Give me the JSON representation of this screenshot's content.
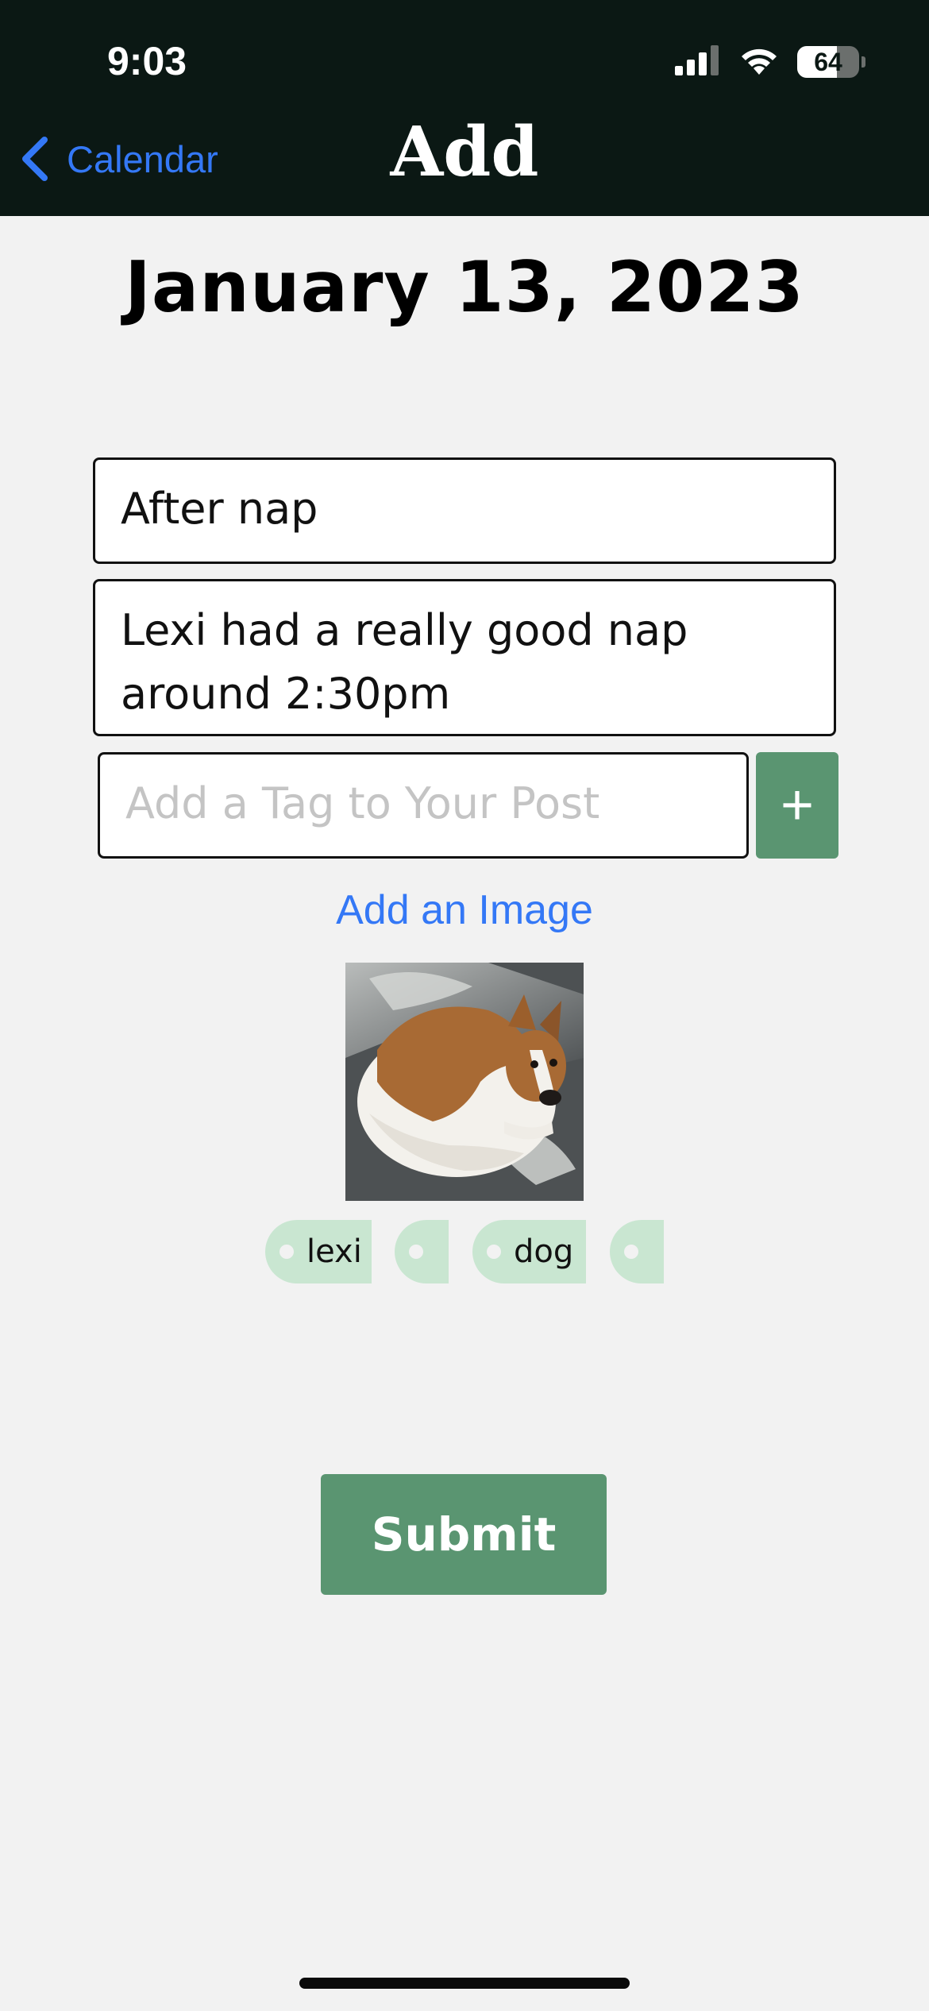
{
  "status_bar": {
    "time": "9:03",
    "battery": "64",
    "battery_level": 0.64
  },
  "nav": {
    "back_label": "Calendar",
    "title": "Add"
  },
  "date": "January 13, 2023",
  "form": {
    "title_value": "After nap",
    "description_value": "Lexi had a really good nap around 2:30pm",
    "tag_placeholder": "Add a Tag to Your Post",
    "add_tag_symbol": "+",
    "add_image_label": "Add an Image",
    "image_alt": "dog",
    "submit_label": "Submit"
  },
  "tags": [
    {
      "label": "lexi"
    },
    {
      "label": ""
    },
    {
      "label": "dog"
    },
    {
      "label": ""
    }
  ],
  "colors": {
    "header_bg": "#0b1814",
    "accent_green": "#5a9571",
    "tag_green": "#c9e6d1",
    "link_blue": "#3478f6",
    "page_bg": "#f2f2f2"
  }
}
